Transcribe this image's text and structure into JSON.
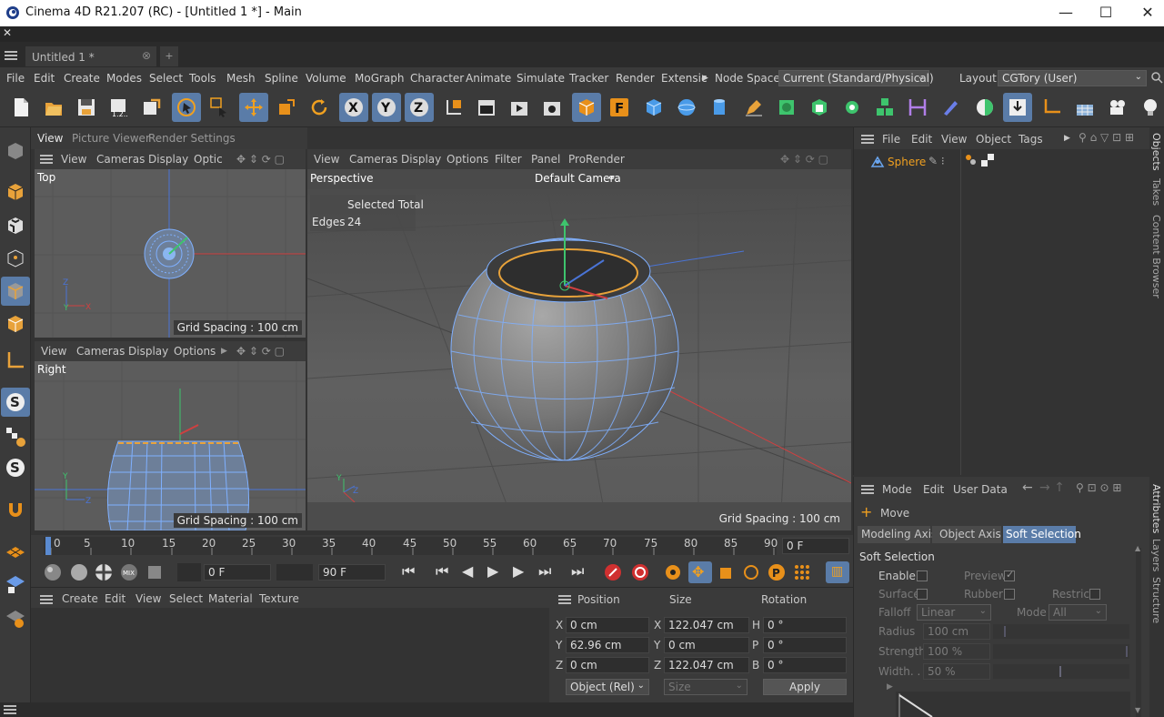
{
  "window": {
    "title": "Cinema 4D R21.207 (RC) - [Untitled 1 *] - Main",
    "min": "—",
    "max": "☐",
    "close": "✕"
  },
  "strip": {
    "close": "✕"
  },
  "tabs": {
    "doc": "Untitled 1 *",
    "doc_close": "⊗",
    "add": "+"
  },
  "menu": {
    "items": [
      "File",
      "Edit",
      "Create",
      "Modes",
      "Select",
      "Tools",
      "Mesh",
      "Spline",
      "Volume",
      "MoGraph",
      "Character",
      "Animate",
      "Simulate",
      "Tracker",
      "Render",
      "Extensic"
    ],
    "node_space_label": "Node Space:",
    "node_space_value": "Current (Standard/Physical)",
    "layout_label": "Layout:",
    "layout_value": "CGTory (User)"
  },
  "left_panel_tabs": [
    "View",
    "Picture Viewer",
    "Render Settings"
  ],
  "viewport_top": {
    "menu": [
      "View",
      "Cameras",
      "Display",
      "Optic"
    ],
    "label": "Top",
    "grid": "Grid Spacing : 100 cm"
  },
  "viewport_right": {
    "menu": [
      "View",
      "Cameras",
      "Display",
      "Options"
    ],
    "label": "Right",
    "grid": "Grid Spacing : 100 cm"
  },
  "viewport_persp": {
    "menu": [
      "View",
      "Cameras",
      "Display",
      "Options",
      "Filter",
      "Panel",
      "ProRender"
    ],
    "label": "Perspective",
    "camera": "Default Camera",
    "selected_total": "Selected Total",
    "edges_label": "Edges",
    "edges_value": "24",
    "grid": "Grid Spacing : 100 cm"
  },
  "timeline": {
    "ticks": [
      "0",
      "5",
      "10",
      "15",
      "20",
      "25",
      "30",
      "35",
      "40",
      "45",
      "50",
      "55",
      "60",
      "65",
      "70",
      "75",
      "80",
      "85",
      "90"
    ],
    "current_frame": "0 F"
  },
  "anim": {
    "start": "0 F",
    "end": "90 F"
  },
  "material_manager": {
    "menu": [
      "Create",
      "Edit",
      "View",
      "Select",
      "Material",
      "Texture"
    ]
  },
  "coordinates": {
    "headers": [
      "Position",
      "Size",
      "Rotation"
    ],
    "rows": [
      {
        "axis": "X",
        "pos": "0 cm",
        "saxis": "X",
        "size": "122.047 cm",
        "raxis": "H",
        "rot": "0 °"
      },
      {
        "axis": "Y",
        "pos": "62.96 cm",
        "saxis": "Y",
        "size": "0 cm",
        "raxis": "P",
        "rot": "0 °"
      },
      {
        "axis": "Z",
        "pos": "0 cm",
        "saxis": "Z",
        "size": "122.047 cm",
        "raxis": "B",
        "rot": "0 °"
      }
    ],
    "mode": "Object (Rel)",
    "size_mode": "Size",
    "apply": "Apply"
  },
  "object_manager": {
    "menu": [
      "File",
      "Edit",
      "View",
      "Object",
      "Tags"
    ],
    "object_name": "Sphere"
  },
  "attributes": {
    "menu": [
      "Mode",
      "Edit",
      "User Data"
    ],
    "tool": "Move",
    "tabs": [
      "Modeling Axis",
      "Object Axis",
      "Soft Selection"
    ],
    "section": "Soft Selection",
    "enable": "Enable",
    "preview": "Preview",
    "surface": "Surface",
    "rubber": "Rubber",
    "restrict": "Restrict",
    "falloff_label": "Falloff",
    "falloff_value": "Linear",
    "mode_label": "Mode",
    "mode_value": "All",
    "radius_label": "Radius",
    "radius_value": "100 cm",
    "strength_label": "Strength",
    "strength_value": "100 %",
    "width_label": "Width. .",
    "width_value": "50 %"
  },
  "right_tabs": [
    "Objects",
    "Takes",
    "Content Browser",
    "Attributes",
    "Layers",
    "Structure"
  ]
}
